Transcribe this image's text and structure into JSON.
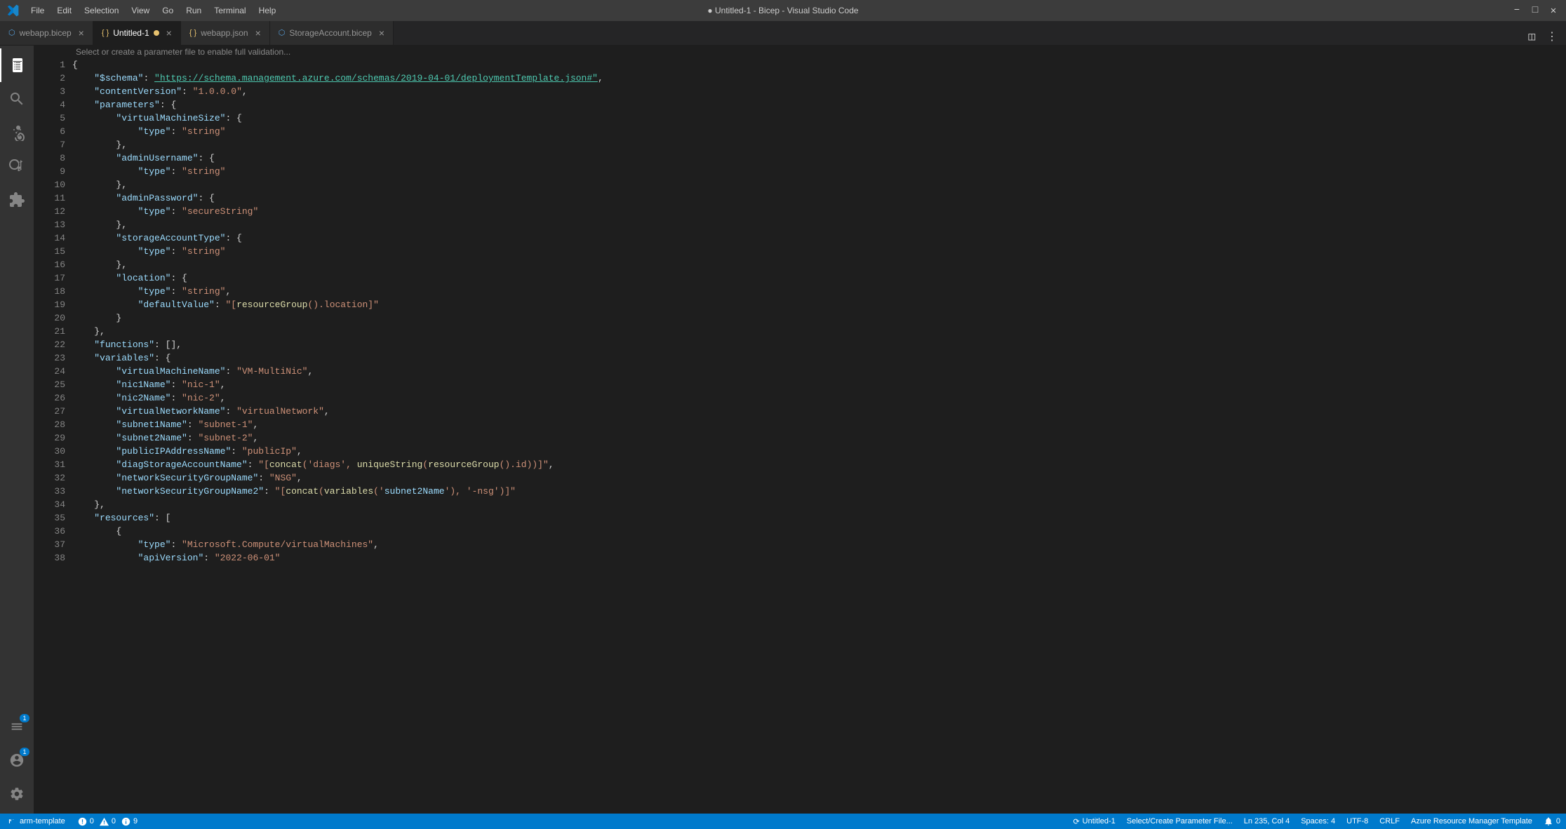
{
  "titleBar": {
    "title": "● Untitled-1 - Bicep - Visual Studio Code",
    "menuItems": [
      "File",
      "Edit",
      "Selection",
      "View",
      "Go",
      "Run",
      "Terminal",
      "Help"
    ]
  },
  "tabs": [
    {
      "id": "webapp-bicep",
      "label": "webapp.bicep",
      "icon": "file",
      "modified": false,
      "active": false
    },
    {
      "id": "untitled-1",
      "label": "Untitled-1",
      "icon": "file",
      "modified": true,
      "active": true
    },
    {
      "id": "webapp-json",
      "label": "webapp.json",
      "icon": "file",
      "modified": false,
      "active": false
    },
    {
      "id": "storageaccount-bicep",
      "label": "StorageAccount.bicep",
      "icon": "file",
      "modified": false,
      "active": false
    }
  ],
  "infoBar": {
    "message": "Select or create a parameter file to enable full validation..."
  },
  "codeLines": [
    {
      "num": 1,
      "content": "{"
    },
    {
      "num": 2,
      "content": "    \"$schema\": \"https://schema.management.azure.com/schemas/2019-04-01/deploymentTemplate.json#\","
    },
    {
      "num": 3,
      "content": "    \"contentVersion\": \"1.0.0.0\","
    },
    {
      "num": 4,
      "content": "    \"parameters\": {"
    },
    {
      "num": 5,
      "content": "        \"virtualMachineSize\": {"
    },
    {
      "num": 6,
      "content": "            \"type\": \"string\""
    },
    {
      "num": 7,
      "content": "        },"
    },
    {
      "num": 8,
      "content": "        \"adminUsername\": {"
    },
    {
      "num": 9,
      "content": "            \"type\": \"string\""
    },
    {
      "num": 10,
      "content": "        },"
    },
    {
      "num": 11,
      "content": "        \"adminPassword\": {"
    },
    {
      "num": 12,
      "content": "            \"type\": \"secureString\""
    },
    {
      "num": 13,
      "content": "        },"
    },
    {
      "num": 14,
      "content": "        \"storageAccountType\": {"
    },
    {
      "num": 15,
      "content": "            \"type\": \"string\""
    },
    {
      "num": 16,
      "content": "        },"
    },
    {
      "num": 17,
      "content": "        \"location\": {"
    },
    {
      "num": 18,
      "content": "            \"type\": \"string\","
    },
    {
      "num": 19,
      "content": "            \"defaultValue\": \"[resourceGroup().location]\""
    },
    {
      "num": 20,
      "content": "        }"
    },
    {
      "num": 21,
      "content": "    },"
    },
    {
      "num": 22,
      "content": "    \"functions\": [],"
    },
    {
      "num": 23,
      "content": "    \"variables\": {"
    },
    {
      "num": 24,
      "content": "        \"virtualMachineName\": \"VM-MultiNic\","
    },
    {
      "num": 25,
      "content": "        \"nic1Name\": \"nic-1\","
    },
    {
      "num": 26,
      "content": "        \"nic2Name\": \"nic-2\","
    },
    {
      "num": 27,
      "content": "        \"virtualNetworkName\": \"virtualNetwork\","
    },
    {
      "num": 28,
      "content": "        \"subnet1Name\": \"subnet-1\","
    },
    {
      "num": 29,
      "content": "        \"subnet2Name\": \"subnet-2\","
    },
    {
      "num": 30,
      "content": "        \"publicIPAddressName\": \"publicIp\","
    },
    {
      "num": 31,
      "content": "        \"diagStorageAccountName\": \"[concat('diags', uniqueString(resourceGroup().id))]\","
    },
    {
      "num": 32,
      "content": "        \"networkSecurityGroupName\": \"NSG\","
    },
    {
      "num": 33,
      "content": "        \"networkSecurityGroupName2\": \"[concat(variables('subnet2Name'), '-nsg')]\""
    },
    {
      "num": 34,
      "content": "    },"
    },
    {
      "num": 35,
      "content": "    \"resources\": ["
    },
    {
      "num": 36,
      "content": "        {"
    },
    {
      "num": 37,
      "content": "            \"type\": \"Microsoft.Compute/virtualMachines\","
    },
    {
      "num": 38,
      "content": "            \"apiVersion\": \"2022-06-01\""
    }
  ],
  "statusBar": {
    "branch": "arm-template",
    "errors": "0",
    "warnings": "0",
    "info": "9",
    "modifiedFile": "Untitled-1",
    "selectParameter": "Select/Create Parameter File...",
    "cursorPos": "Ln 235, Col 4",
    "spaces": "Spaces: 4",
    "encoding": "UTF-8",
    "lineEnding": "CRLF",
    "language": "Azure Resource Manager Template",
    "notifications": "0"
  },
  "activityBar": {
    "icons": [
      {
        "id": "explorer",
        "symbol": "⎘",
        "active": true,
        "badge": null
      },
      {
        "id": "search",
        "symbol": "🔍",
        "active": false,
        "badge": null
      },
      {
        "id": "source-control",
        "symbol": "⑂",
        "active": false,
        "badge": null
      },
      {
        "id": "run-debug",
        "symbol": "▷",
        "active": false,
        "badge": null
      },
      {
        "id": "extensions",
        "symbol": "⊞",
        "active": false,
        "badge": null
      },
      {
        "id": "remote-explorer",
        "symbol": "⊡",
        "active": false,
        "badge": null
      },
      {
        "id": "azure",
        "symbol": "☁",
        "active": false,
        "badge": null
      },
      {
        "id": "live-share",
        "symbol": "↗",
        "active": false,
        "badge": null
      },
      {
        "id": "testing",
        "symbol": "⚗",
        "active": false,
        "badge": null
      },
      {
        "id": "output",
        "symbol": "≡",
        "active": false,
        "badge": null
      }
    ],
    "bottomIcons": [
      {
        "id": "remote",
        "symbol": "⊞",
        "badge": "1"
      },
      {
        "id": "accounts",
        "symbol": "👤",
        "badge": "1"
      },
      {
        "id": "settings",
        "symbol": "⚙",
        "badge": null
      }
    ]
  }
}
